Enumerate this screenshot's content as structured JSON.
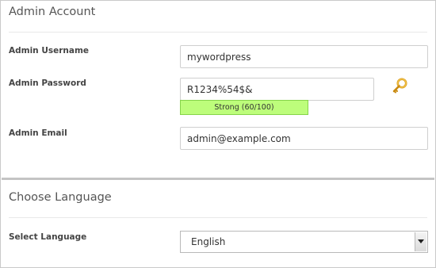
{
  "admin_account": {
    "title": "Admin Account",
    "username_label": "Admin Username",
    "username_value": "mywordpress",
    "password_label": "Admin Password",
    "password_value": "R1234%54$&",
    "strength_text": "Strong (60/100)",
    "email_label": "Admin Email",
    "email_value": "admin@example.com",
    "password_icon": "key-icon"
  },
  "language": {
    "title": "Choose Language",
    "select_label": "Select Language",
    "selected": "English"
  },
  "colors": {
    "strength_bg": "#bdfd7b",
    "key_icon": "#e0a21b"
  }
}
